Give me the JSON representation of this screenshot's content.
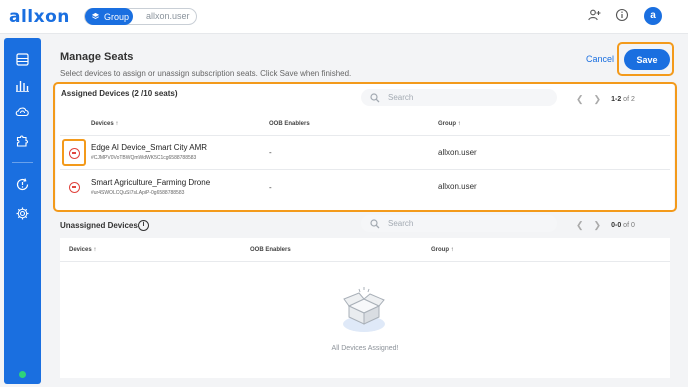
{
  "header": {
    "logo": "allxon",
    "tenant_active": "Group",
    "tenant_other": "allxon.user",
    "avatar_letter": "a"
  },
  "page": {
    "title": "Manage Seats",
    "subtitle": "Select devices to assign or unassign subscription seats. Click Save when finished.",
    "cancel_label": "Cancel",
    "save_label": "Save"
  },
  "assigned": {
    "title": "Assigned Devices (2 /10 seats)",
    "search_placeholder": "Search",
    "pager": "1-2",
    "pager_total": "of 2",
    "columns": [
      "Devices",
      "OOB Enablers",
      "Group"
    ],
    "rows": [
      {
        "name": "Edge AI Device_Smart City AMR",
        "id": "#CJMPV0VoTBWQmWdWK5C1cg6588788583",
        "oob": "-",
        "group": "allxon.user"
      },
      {
        "name": "Smart Agriculture_Farming Drone",
        "id": "#ur4SWOLCQuSI7sLApiP-0g6588788583",
        "oob": "-",
        "group": "allxon.user"
      }
    ]
  },
  "unassigned": {
    "title": "Unassigned Devices",
    "search_placeholder": "Search",
    "pager": "0-0",
    "pager_total": "of 0",
    "columns": [
      "Devices",
      "OOB Enablers",
      "Group"
    ],
    "empty_message": "All Devices Assigned!"
  },
  "colors": {
    "accent": "#1a6fe0",
    "highlight": "#f39a1b",
    "remove": "#e0443e",
    "status_online": "#2ed47a"
  },
  "icons": {
    "add_user": "add-user-icon",
    "info": "info-icon",
    "search": "search-icon",
    "remove": "remove-circle-icon",
    "sort": "sort-up-icon",
    "empty": "empty-box-icon"
  }
}
